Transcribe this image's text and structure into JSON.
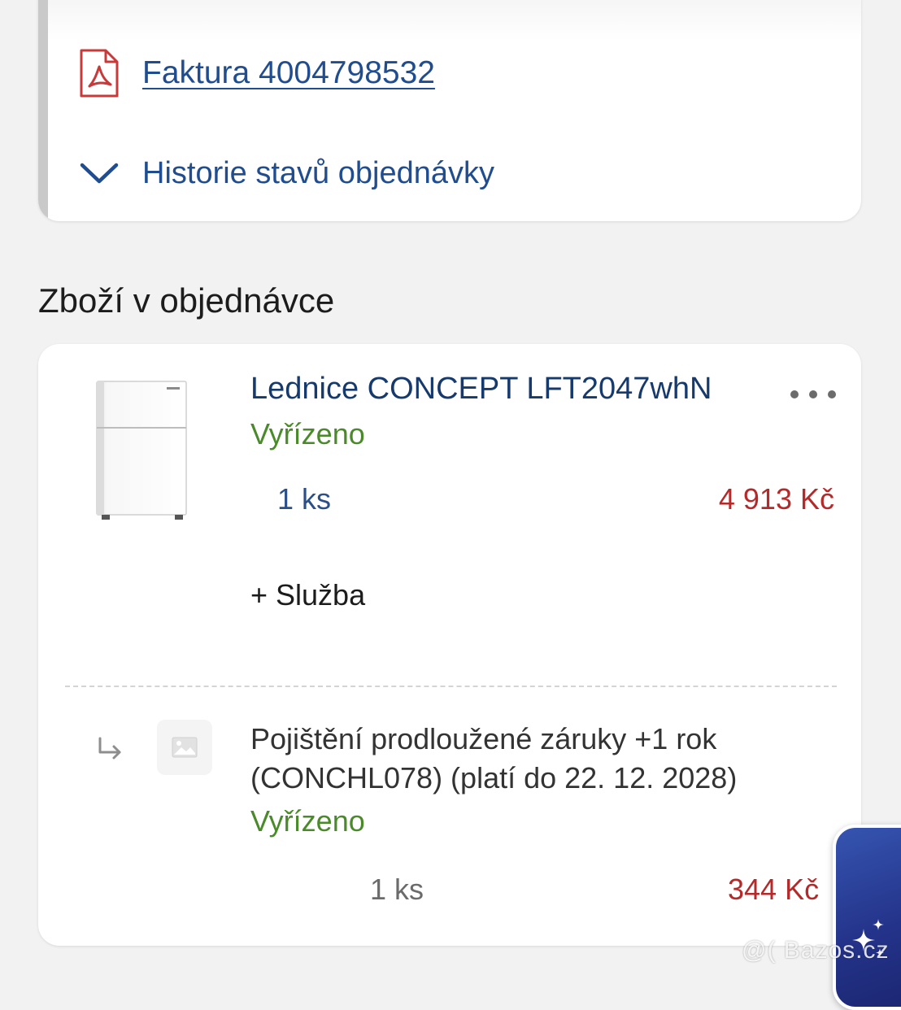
{
  "invoice": {
    "icon": "pdf-file-icon",
    "link_label": "Faktura 4004798532"
  },
  "history": {
    "icon": "chevron-down-icon",
    "label": "Historie stavů objednávky"
  },
  "section": {
    "title": "Zboží v objednávce"
  },
  "items": [
    {
      "name": "Lednice CONCEPT LFT2047whN",
      "status": "Vyřízeno",
      "quantity": "1 ks",
      "price": "4 913 Kč",
      "image": "fridge-image",
      "more_icon": "more-dots-icon",
      "service_label": "+ Služba"
    },
    {
      "name": "Pojištění prodloužené záruky +1 rok (CONCHL078) (platí do 22. 12. 2028)",
      "status": "Vyřízeno",
      "quantity": "1 ks",
      "price": "344 Kč",
      "image": "image-placeholder-icon",
      "relation_icon": "subitem-arrow-icon"
    }
  ],
  "assistant_button": {
    "icon": "sparkle-icon"
  },
  "watermark": "@( Bazos.cz",
  "colors": {
    "link_blue": "#1f4d8f",
    "title_navy": "#173a6d",
    "status_green": "#4a8a2a",
    "price_red": "#b42a2a",
    "pdf_red": "#c8393a",
    "background": "#f2f2f2"
  }
}
